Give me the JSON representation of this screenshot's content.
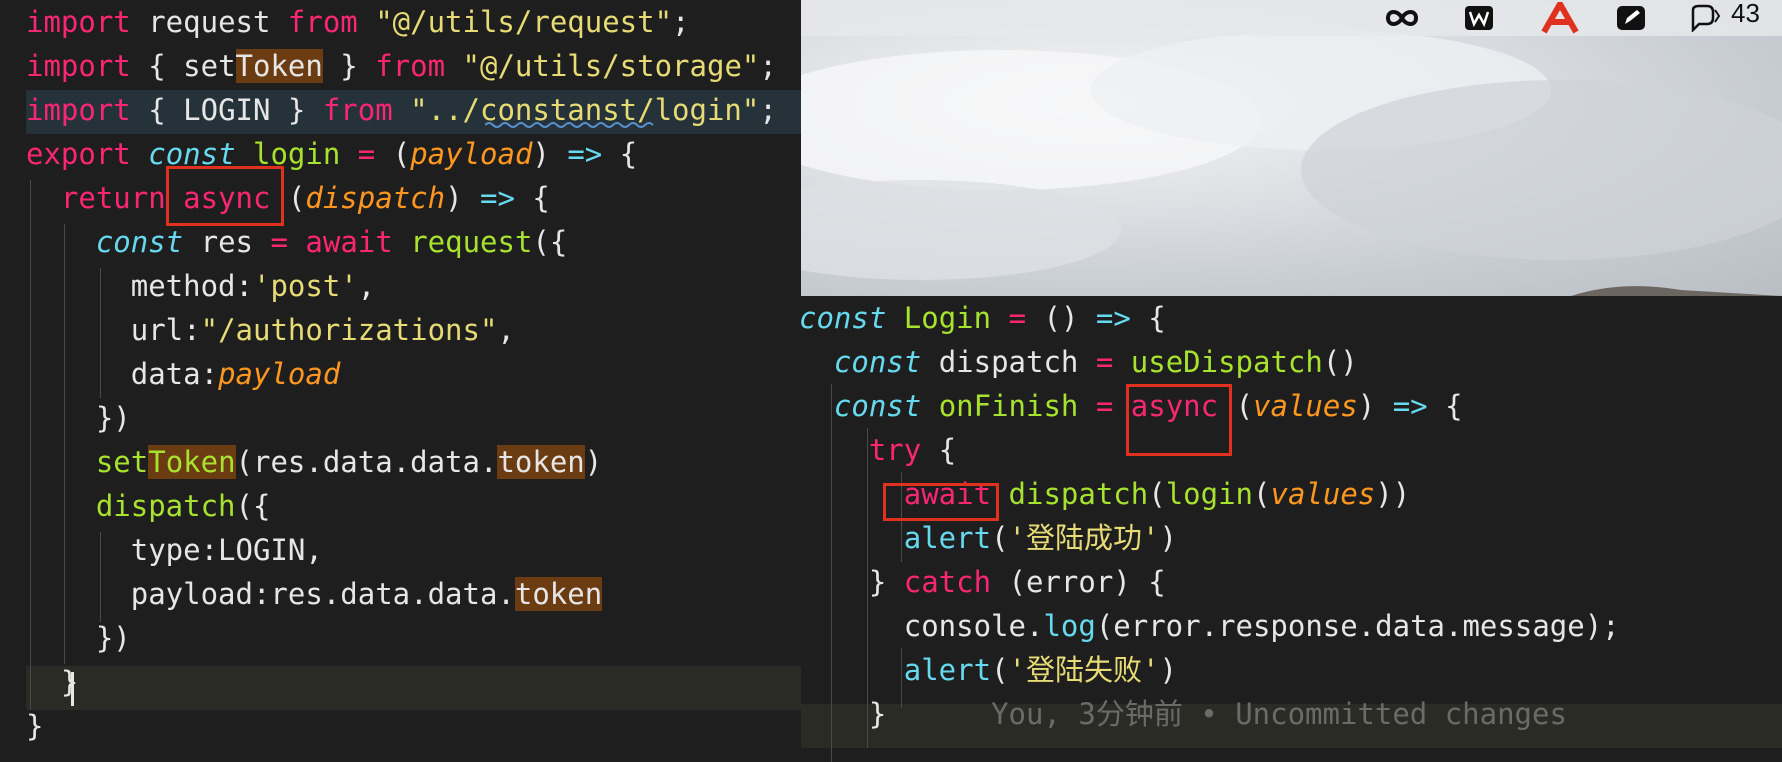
{
  "left_code": [
    [
      [
        "k",
        "import"
      ],
      [
        "w",
        " request "
      ],
      [
        "k",
        "from"
      ],
      [
        "w",
        " "
      ],
      [
        "s",
        "\"@/utils/request\""
      ],
      [
        "w",
        ";"
      ]
    ],
    [
      [
        "k",
        "import"
      ],
      [
        "w",
        " { set"
      ],
      [
        "hw",
        "Token"
      ],
      [
        "w",
        " } "
      ],
      [
        "k",
        "from"
      ],
      [
        "w",
        " "
      ],
      [
        "s",
        "\"@/utils/storage\""
      ],
      [
        "w",
        ";"
      ]
    ],
    [
      [
        "k",
        "import"
      ],
      [
        "w",
        " { LOGIN } "
      ],
      [
        "k",
        "from"
      ],
      [
        "w",
        " "
      ],
      [
        "s",
        "\"../constanst/login\""
      ],
      [
        "w",
        ";"
      ]
    ],
    [
      [
        "k",
        "export"
      ],
      [
        "w",
        " "
      ],
      [
        "i",
        "const"
      ],
      [
        "w",
        " "
      ],
      [
        "f",
        "login"
      ],
      [
        "w",
        " "
      ],
      [
        "k",
        "="
      ],
      [
        "w",
        " ("
      ],
      [
        "p",
        "payload"
      ],
      [
        "w",
        ") "
      ],
      [
        "c",
        "=>"
      ],
      [
        "w",
        " {"
      ]
    ],
    [
      [
        "w",
        "  "
      ],
      [
        "k",
        "return"
      ],
      [
        "w",
        " "
      ],
      [
        "k",
        "async"
      ],
      [
        "w",
        " ("
      ],
      [
        "p",
        "dispatch"
      ],
      [
        "w",
        ") "
      ],
      [
        "c",
        "=>"
      ],
      [
        "w",
        " {"
      ]
    ],
    [
      [
        "w",
        "    "
      ],
      [
        "i",
        "const"
      ],
      [
        "w",
        " res "
      ],
      [
        "k",
        "="
      ],
      [
        "w",
        " "
      ],
      [
        "k",
        "await"
      ],
      [
        "w",
        " "
      ],
      [
        "f",
        "request"
      ],
      [
        "w",
        "({"
      ]
    ],
    [
      [
        "w",
        "      method:"
      ],
      [
        "s",
        "'post'"
      ],
      [
        "w",
        ","
      ]
    ],
    [
      [
        "w",
        "      url:"
      ],
      [
        "s",
        "\"/authorizations\""
      ],
      [
        "w",
        ","
      ]
    ],
    [
      [
        "w",
        "      data:"
      ],
      [
        "p",
        "payload"
      ]
    ],
    [
      [
        "w",
        "    })"
      ]
    ],
    [
      [
        "w",
        "    "
      ],
      [
        "f",
        "set"
      ],
      [
        "hf",
        "Token"
      ],
      [
        "w",
        "(res.data.data."
      ],
      [
        "hw",
        "token"
      ],
      [
        "w",
        ")"
      ]
    ],
    [
      [
        "w",
        "    "
      ],
      [
        "f",
        "dispatch"
      ],
      [
        "w",
        "({"
      ]
    ],
    [
      [
        "w",
        "      type:LOGIN,"
      ]
    ],
    [
      [
        "w",
        "      payload:res.data.data."
      ],
      [
        "hw",
        "token"
      ]
    ],
    [
      [
        "w",
        "    })"
      ]
    ],
    [
      [
        "w",
        "  }"
      ]
    ],
    [
      [
        "w",
        "}"
      ]
    ]
  ],
  "right_code": [
    [
      [
        "i",
        "const"
      ],
      [
        "w",
        " "
      ],
      [
        "f",
        "Login"
      ],
      [
        "w",
        " "
      ],
      [
        "k",
        "="
      ],
      [
        "w",
        " () "
      ],
      [
        "c",
        "=>"
      ],
      [
        "w",
        " {"
      ]
    ],
    [
      [
        "w",
        "  "
      ],
      [
        "i",
        "const"
      ],
      [
        "w",
        " dispatch "
      ],
      [
        "k",
        "="
      ],
      [
        "w",
        " "
      ],
      [
        "f",
        "useDispatch"
      ],
      [
        "w",
        "()"
      ]
    ],
    [
      [
        "w",
        "  "
      ],
      [
        "i",
        "const"
      ],
      [
        "w",
        " "
      ],
      [
        "f",
        "onFinish"
      ],
      [
        "w",
        " "
      ],
      [
        "k",
        "="
      ],
      [
        "w",
        " "
      ],
      [
        "k",
        "async"
      ],
      [
        "w",
        " ("
      ],
      [
        "p",
        "values"
      ],
      [
        "w",
        ") "
      ],
      [
        "c",
        "=>"
      ],
      [
        "w",
        " {"
      ]
    ],
    [
      [
        "w",
        "    "
      ],
      [
        "k",
        "try"
      ],
      [
        "w",
        " {"
      ]
    ],
    [
      [
        "w",
        "      "
      ],
      [
        "k",
        "await"
      ],
      [
        "w",
        " "
      ],
      [
        "f",
        "dispatch"
      ],
      [
        "w",
        "("
      ],
      [
        "f",
        "login"
      ],
      [
        "w",
        "("
      ],
      [
        "p",
        "values"
      ],
      [
        "w",
        "))"
      ]
    ],
    [
      [
        "w",
        "      "
      ],
      [
        "c",
        "alert"
      ],
      [
        "w",
        "("
      ],
      [
        "s",
        "'登陆成功'"
      ],
      [
        "w",
        ")"
      ]
    ],
    [
      [
        "w",
        "    } "
      ],
      [
        "k",
        "catch"
      ],
      [
        "w",
        " (error) {"
      ]
    ],
    [
      [
        "w",
        "      console."
      ],
      [
        "c",
        "log"
      ],
      [
        "w",
        "(error.response.data.message);"
      ]
    ],
    [
      [
        "w",
        "      "
      ],
      [
        "c",
        "alert"
      ],
      [
        "w",
        "("
      ],
      [
        "s",
        "'登陆失败'"
      ],
      [
        "w",
        ")"
      ]
    ],
    [
      [
        "w",
        "    }"
      ],
      [
        "b",
        "      You, 3分钟前 • Uncommitted changes"
      ]
    ]
  ],
  "toolbar": {
    "badge_count": "43"
  },
  "colors": {
    "highlight_box": "#e0301e",
    "editor_bg": "#1e1e1e"
  }
}
